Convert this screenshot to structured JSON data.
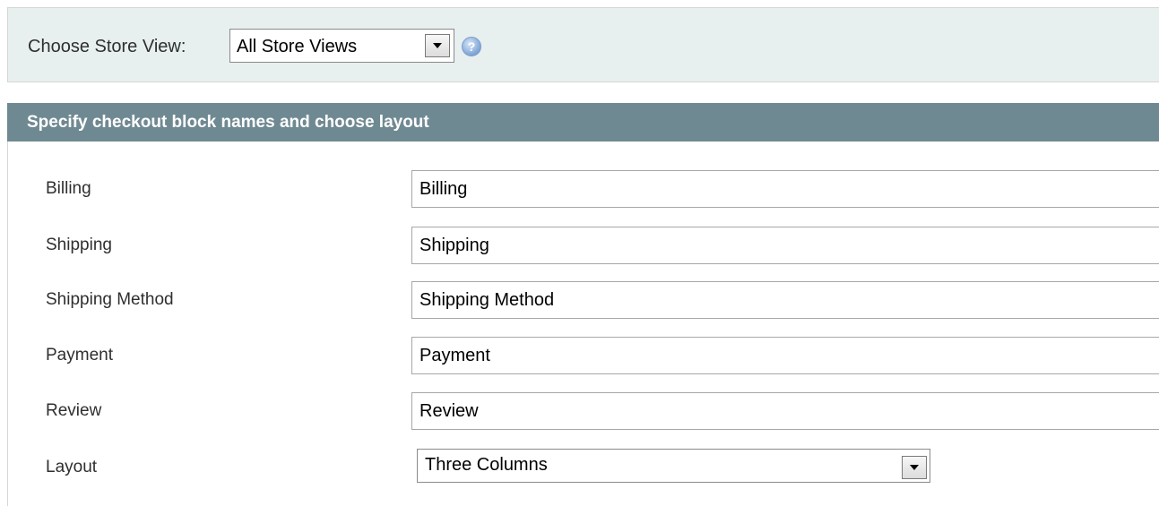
{
  "store_switcher": {
    "label": "Choose Store View:",
    "selected": "All Store Views",
    "help_icon": "help-icon"
  },
  "section": {
    "title": "Specify checkout block names and choose layout"
  },
  "fields": [
    {
      "label": "Billing",
      "value": "Billing"
    },
    {
      "label": "Shipping",
      "value": "Shipping"
    },
    {
      "label": "Shipping Method",
      "value": "Shipping Method"
    },
    {
      "label": "Payment",
      "value": "Payment"
    },
    {
      "label": "Review",
      "value": "Review"
    }
  ],
  "layout_field": {
    "label": "Layout",
    "selected": "Three Columns"
  },
  "colors": {
    "switcher_bg": "#e7efef",
    "header_bg": "#6f8992"
  }
}
